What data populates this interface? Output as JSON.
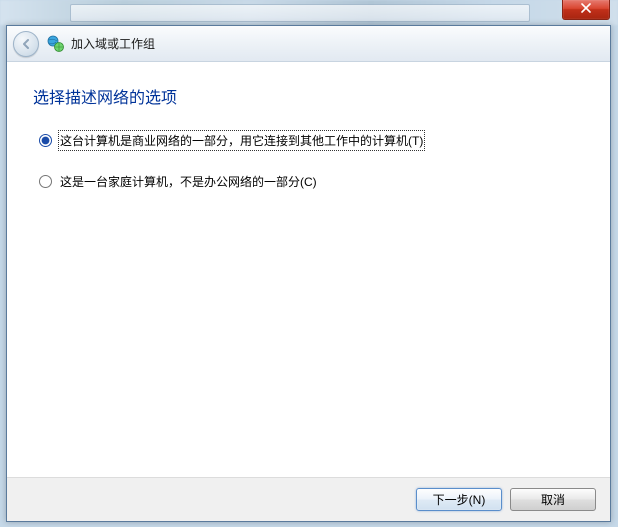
{
  "titlebar": {
    "close_tooltip": "关闭"
  },
  "wizard": {
    "title": "加入域或工作组",
    "heading": "选择描述网络的选项",
    "options": [
      {
        "label": "这台计算机是商业网络的一部分，用它连接到其他工作中的计算机(T)",
        "selected": true
      },
      {
        "label": "这是一台家庭计算机，不是办公网络的一部分(C)",
        "selected": false
      }
    ],
    "buttons": {
      "next": "下一步(N)",
      "cancel": "取消"
    }
  }
}
